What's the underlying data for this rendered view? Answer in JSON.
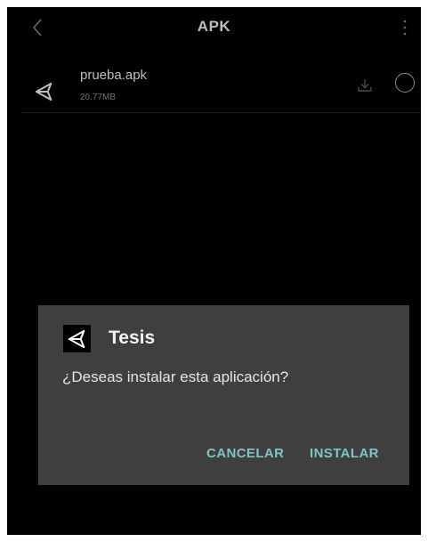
{
  "app_bar": {
    "title": "APK",
    "back_icon": "chevron-left-icon",
    "menu_icon": "more-vert-icon"
  },
  "files": [
    {
      "name": "prueba.apk",
      "size": "20.77MB",
      "icon": "unity-logo-icon"
    }
  ],
  "dialog": {
    "app_name": "Tesis",
    "message": "¿Deseas instalar esta aplicación?",
    "cancel_label": "CANCELAR",
    "install_label": "INSTALAR",
    "accent_color": "#7fc5c2"
  },
  "colors": {
    "background": "#000000",
    "dialog_background": "#3f3f3f"
  }
}
